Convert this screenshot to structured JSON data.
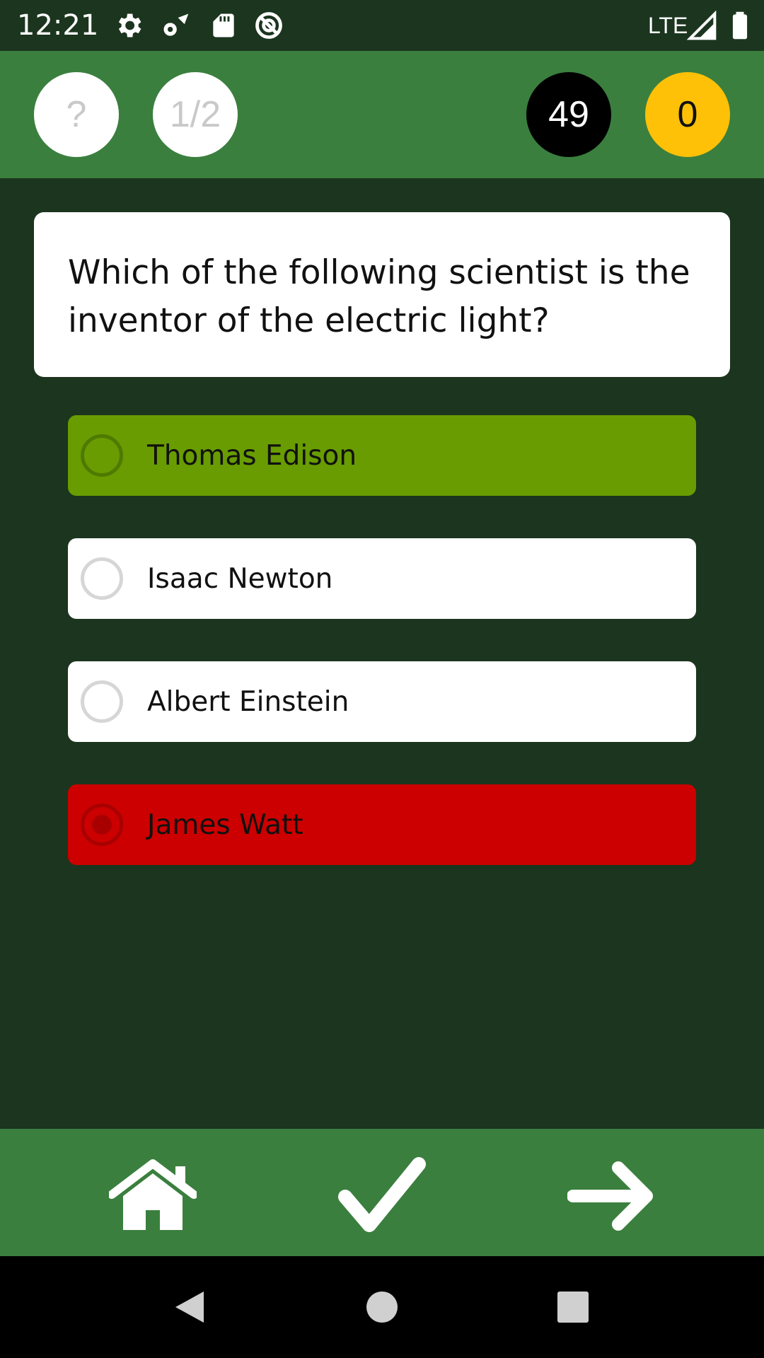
{
  "status_bar": {
    "time": "12:21",
    "network": "LTE",
    "icons": [
      "settings-icon",
      "wifi-settings-icon",
      "sd-card-icon",
      "data-saver-icon",
      "signal-icon",
      "battery-icon"
    ]
  },
  "header": {
    "help_label": "?",
    "progress_label": "1/2",
    "timer_value": "49",
    "score_value": "0"
  },
  "question": {
    "text": "Which of the following scientist is the inventor of the electric light?"
  },
  "options": [
    {
      "label": "Thomas Edison",
      "state": "correct"
    },
    {
      "label": "Isaac Newton",
      "state": "default"
    },
    {
      "label": "Albert Einstein",
      "state": "default"
    },
    {
      "label": "James Watt",
      "state": "wrong-selected"
    }
  ],
  "toolbar": {
    "buttons": [
      "home-icon",
      "check-icon",
      "arrow-right-icon"
    ]
  },
  "colors": {
    "background": "#1b351e",
    "header": "#3a7f3e",
    "correct": "#689c00",
    "wrong": "#cc0000",
    "score": "#ffc107"
  }
}
